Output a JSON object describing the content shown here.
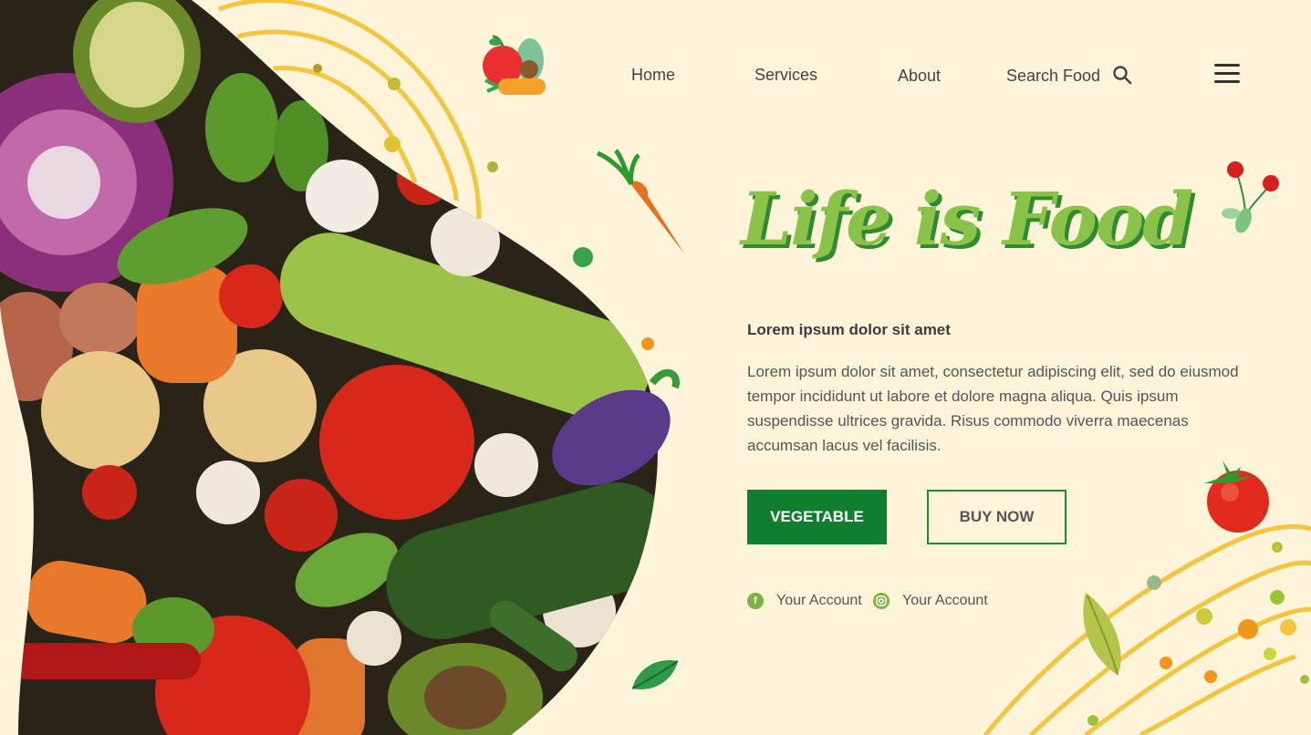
{
  "nav": {
    "links": [
      "Home",
      "Services",
      "About",
      "Search Food"
    ]
  },
  "icons": {
    "logo": "fruit-basket-logo",
    "search": "search-icon",
    "menu": "hamburger-menu-icon",
    "facebook": "facebook-icon",
    "instagram": "instagram-icon"
  },
  "hero": {
    "title": "Life is Food",
    "subheading": "Lorem ipsum dolor sit amet",
    "body": "Lorem ipsum dolor sit amet, consectetur adipiscing elit, sed do eiusmod tempor incididunt ut labore et dolore magna aliqua. Quis ipsum suspendisse ultrices gravida. Risus commodo viverra maecenas accumsan lacus vel facilisis."
  },
  "buttons": {
    "primary": "VEGETABLE",
    "secondary": "BUY NOW"
  },
  "social": [
    {
      "label": "Your Account",
      "icon": "facebook-icon"
    },
    {
      "label": "Your Account",
      "icon": "instagram-icon"
    }
  ],
  "colors": {
    "background": "#fdf4d9",
    "primary_green": "#0d7f2f",
    "title_green": "#8bc34a",
    "accent_yellow": "#f5c542"
  }
}
